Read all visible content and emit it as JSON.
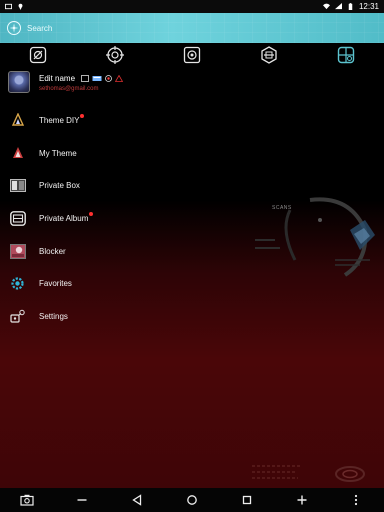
{
  "status_bar": {
    "time": "12:31",
    "left_icons": [
      "screenshot-icon",
      "location-pin-icon"
    ],
    "right_icons": [
      "wifi-icon",
      "signal-icon",
      "battery-icon"
    ]
  },
  "search": {
    "placeholder": "Search"
  },
  "tabs": [
    {
      "icon": "theme-tab-icon",
      "active": false
    },
    {
      "icon": "target-tab-icon",
      "active": false
    },
    {
      "icon": "scan-tab-icon",
      "active": false
    },
    {
      "icon": "hexagon-tab-icon",
      "active": false
    },
    {
      "icon": "grid-tab-icon",
      "active": true
    }
  ],
  "profile": {
    "name": "Edit name",
    "email": "sethomas@gmail.com"
  },
  "menu": {
    "items": [
      {
        "label": "Theme DIY",
        "icon": "theme-diy-icon",
        "badge": true
      },
      {
        "label": "My Theme",
        "icon": "my-theme-icon",
        "badge": false
      },
      {
        "label": "Private Box",
        "icon": "private-box-icon",
        "badge": false
      },
      {
        "label": "Private Album",
        "icon": "private-album-icon",
        "badge": true
      },
      {
        "label": "Blocker",
        "icon": "blocker-icon",
        "badge": false
      },
      {
        "label": "Favorites",
        "icon": "favorites-icon",
        "badge": false
      },
      {
        "label": "Settings",
        "icon": "settings-icon",
        "badge": false
      }
    ]
  },
  "decoration": {
    "label": "SCANS"
  },
  "colors": {
    "accent": "#5cc4cf",
    "background_red": "#4a0608",
    "badge": "#ff3030",
    "email": "#c03a3a"
  },
  "nav_bar": {
    "buttons": [
      "camera-icon",
      "minus-icon",
      "back-icon",
      "home-icon",
      "recents-icon",
      "plus-icon",
      "more-icon"
    ]
  }
}
